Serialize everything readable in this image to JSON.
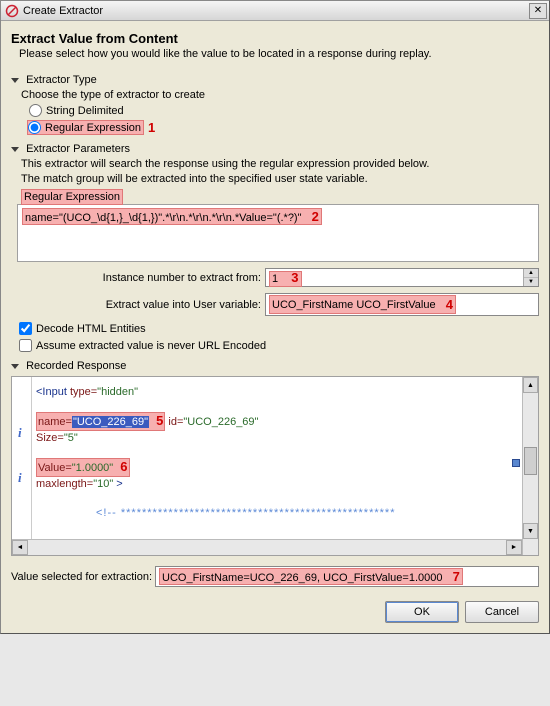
{
  "window": {
    "title": "Create Extractor"
  },
  "header": {
    "title": "Extract Value from Content",
    "desc": "Please select how you would like the value to be located in a response during replay."
  },
  "extractor_type": {
    "header": "Extractor Type",
    "choose": "Choose the type of extractor to create",
    "string_delimited": "String Delimited",
    "regex": "Regular Expression"
  },
  "params": {
    "header": "Extractor Parameters",
    "explain1": "This extractor will search the response using the regular expression provided below.",
    "explain2": "The match group will be extracted into the specified user state variable.",
    "regex_label": "Regular Expression",
    "regex_value": "name=\"(UCO_\\d{1,}_\\d{1,})\".*\\r\\n.*\\r\\n.*\\r\\n.*Value=\"(.*?)\"",
    "instance_label": "Instance number to extract from:",
    "instance_value": "1",
    "uservar_label": "Extract value into User variable:",
    "uservar_value": "UCO_FirstName UCO_FirstValue",
    "decode_label": "Decode HTML Entities",
    "assume_label": "Assume extracted value is never URL Encoded"
  },
  "recorded": {
    "header": "Recorded Response",
    "line_input_open": "<Input",
    "line_input_attr": " type=",
    "line_input_val": "\"hidden\"",
    "name_attr": "name=",
    "name_val": "\"UCO_226_69\"",
    "id_attr": " id=",
    "id_val": "\"UCO_226_69\"",
    "size_attr": "Size=",
    "size_val": "\"5\"",
    "value_attr": " Value=",
    "value_val": "\"1.0000\"",
    "maxlen_attr": "maxlength=",
    "maxlen_val": "\"10\"",
    "close": "  >",
    "comment_open": "<!--  ",
    "stars": "****************************************************"
  },
  "footer": {
    "label": "Value selected for extraction:",
    "value": "UCO_FirstName=UCO_226_69, UCO_FirstValue=1.0000"
  },
  "buttons": {
    "ok": "OK",
    "cancel": "Cancel"
  },
  "callouts": {
    "c1": "1",
    "c2": "2",
    "c3": "3",
    "c4": "4",
    "c5": "5",
    "c6": "6",
    "c7": "7"
  }
}
